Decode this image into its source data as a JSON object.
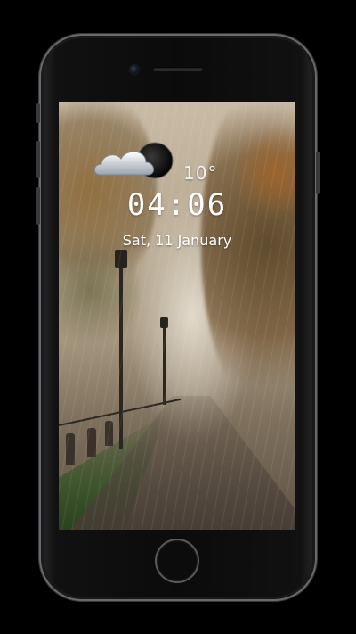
{
  "lockscreen": {
    "weather": {
      "icon": "cloud-moon-icon",
      "temperature": "10°"
    },
    "time": "04:06",
    "date": "Sat, 11 January"
  },
  "colors": {
    "background": "#000000",
    "frame": "#0b0b0b",
    "text": "#ffffff"
  }
}
